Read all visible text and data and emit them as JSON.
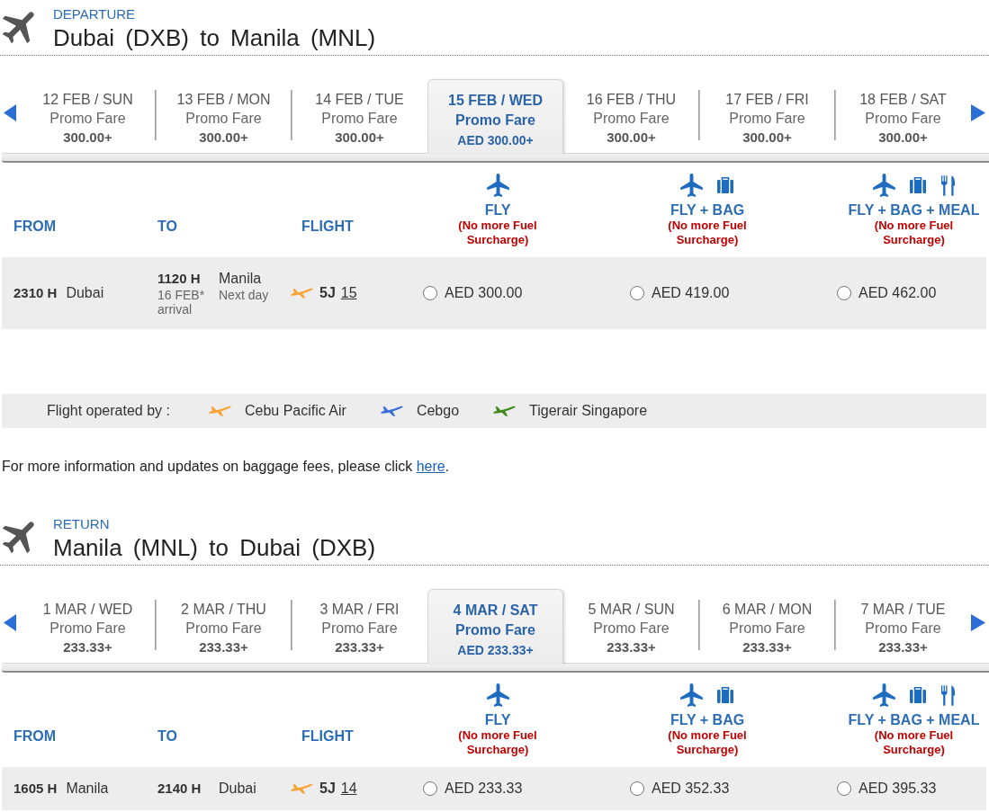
{
  "departure": {
    "label": "DEPARTURE",
    "title": "Dubai (DXB) to Manila (MNL)",
    "dates": [
      {
        "date": "12 FEB / SUN",
        "fare_type": "Promo Fare",
        "price": "300.00+",
        "selected": false
      },
      {
        "date": "13 FEB / MON",
        "fare_type": "Promo Fare",
        "price": "300.00+",
        "selected": false
      },
      {
        "date": "14 FEB / TUE",
        "fare_type": "Promo Fare",
        "price": "300.00+",
        "selected": false
      },
      {
        "date": "15 FEB / WED",
        "fare_type": "Promo Fare",
        "price": "AED 300.00+",
        "selected": true
      },
      {
        "date": "16 FEB / THU",
        "fare_type": "Promo Fare",
        "price": "300.00+",
        "selected": false
      },
      {
        "date": "17 FEB / FRI",
        "fare_type": "Promo Fare",
        "price": "300.00+",
        "selected": false
      },
      {
        "date": "18 FEB / SAT",
        "fare_type": "Promo Fare",
        "price": "300.00+",
        "selected": false
      }
    ],
    "columns": [
      "FROM",
      "TO",
      "FLIGHT"
    ],
    "fare_columns": [
      {
        "kind": "fly",
        "name": "FLY",
        "note": "(No more Fuel Surcharge)"
      },
      {
        "kind": "fly_bag",
        "name": "FLY + BAG",
        "note": "(No more Fuel Surcharge)"
      },
      {
        "kind": "fly_bag_meal",
        "name": "FLY + BAG + MEAL",
        "note": "(No more Fuel Surcharge)"
      }
    ],
    "flights": [
      {
        "depart_time": "2310 H",
        "depart_city": "Dubai",
        "arrive_time": "1120 H",
        "arrive_city": "Manila",
        "arrive_date": "16 FEB* arrival",
        "day_note": "Next day",
        "color": "#f8a334",
        "carrier": "5J",
        "number": "15",
        "fares": [
          {
            "price": "AED 300.00",
            "selected": false
          },
          {
            "price": "AED 419.00",
            "selected": false
          },
          {
            "price": "AED 462.00",
            "selected": false
          }
        ]
      }
    ]
  },
  "operated_by": {
    "label": "Flight operated by :",
    "operators": [
      {
        "name": "Cebu Pacific Air",
        "color": "#f8a334"
      },
      {
        "name": "Cebgo",
        "color": "#3a6fd6"
      },
      {
        "name": "Tigerair Singapore",
        "color": "#3f8b1f"
      }
    ]
  },
  "baggage_note": {
    "text": "For more information and updates on baggage fees, please click",
    "link": "here",
    "end": "."
  },
  "return": {
    "label": "RETURN",
    "title": "Manila (MNL) to Dubai (DXB)",
    "dates": [
      {
        "date": "1 MAR / WED",
        "fare_type": "Promo Fare",
        "price": "233.33+",
        "selected": false
      },
      {
        "date": "2 MAR / THU",
        "fare_type": "Promo Fare",
        "price": "233.33+",
        "selected": false
      },
      {
        "date": "3 MAR / FRI",
        "fare_type": "Promo Fare",
        "price": "233.33+",
        "selected": false
      },
      {
        "date": "4 MAR / SAT",
        "fare_type": "Promo Fare",
        "price": "AED 233.33+",
        "selected": true
      },
      {
        "date": "5 MAR / SUN",
        "fare_type": "Promo Fare",
        "price": "233.33+",
        "selected": false
      },
      {
        "date": "6 MAR / MON",
        "fare_type": "Promo Fare",
        "price": "233.33+",
        "selected": false
      },
      {
        "date": "7 MAR / TUE",
        "fare_type": "Promo Fare",
        "price": "233.33+",
        "selected": false
      }
    ],
    "columns": [
      "FROM",
      "TO",
      "FLIGHT"
    ],
    "fare_columns": [
      {
        "kind": "fly",
        "name": "FLY",
        "note": "(No more Fuel Surcharge)"
      },
      {
        "kind": "fly_bag",
        "name": "FLY + BAG",
        "note": "(No more Fuel Surcharge)"
      },
      {
        "kind": "fly_bag_meal",
        "name": "FLY + BAG + MEAL",
        "note": "(No more Fuel Surcharge)"
      }
    ],
    "flights": [
      {
        "depart_time": "1605 H",
        "depart_city": "Manila",
        "arrive_time": "2140 H",
        "arrive_city": "Dubai",
        "color": "#f8a334",
        "carrier": "5J",
        "number": "14",
        "fares": [
          {
            "price": "AED 233.33",
            "selected": false
          },
          {
            "price": "AED 352.33",
            "selected": false
          },
          {
            "price": "AED 395.33",
            "selected": false
          }
        ]
      }
    ]
  }
}
